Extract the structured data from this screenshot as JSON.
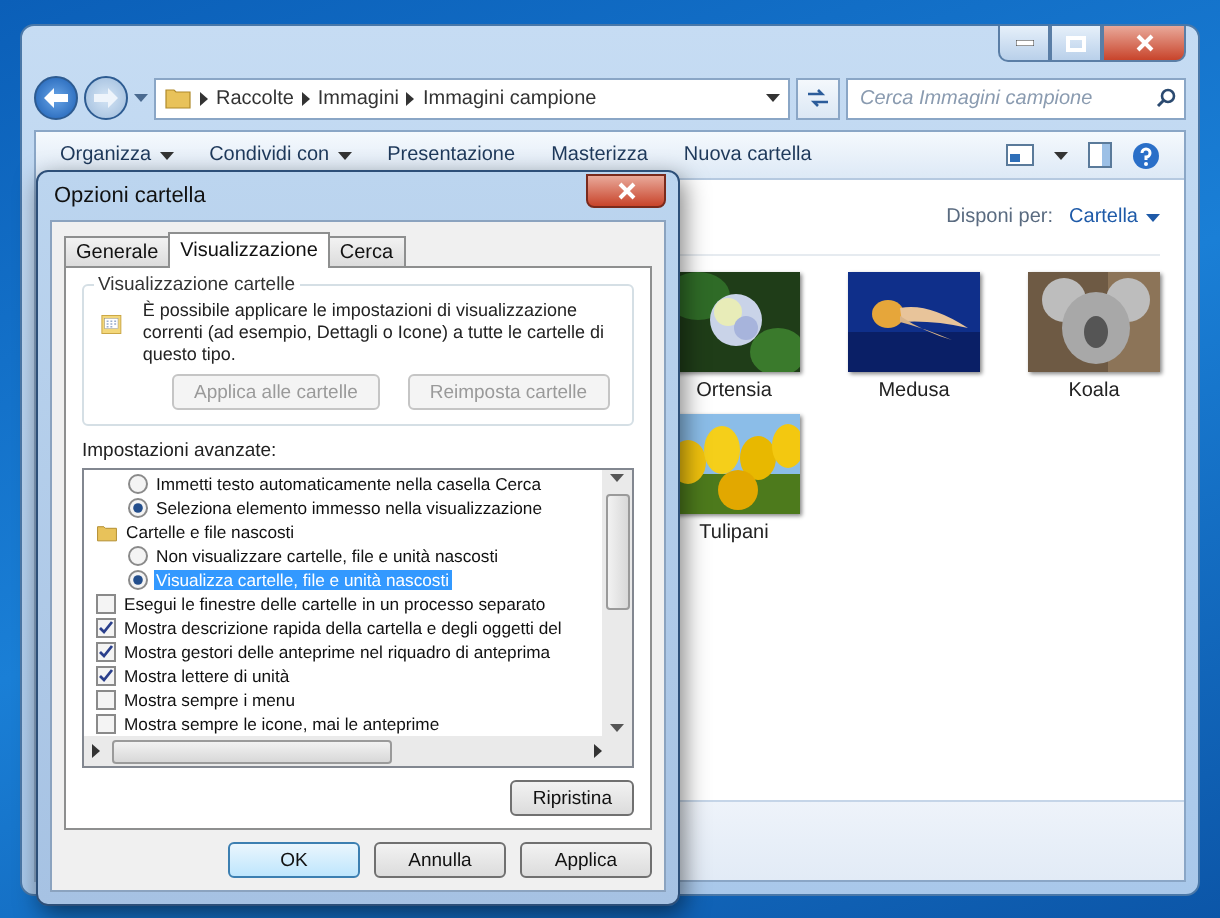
{
  "explorer": {
    "breadcrumb": [
      "Raccolte",
      "Immagini",
      "Immagini campione"
    ],
    "search": {
      "placeholder": "Cerca Immagini campione"
    },
    "toolbar": [
      {
        "label": "Organizza",
        "dropdown": true
      },
      {
        "label": "Condividi con",
        "dropdown": true
      },
      {
        "label": "Presentazione",
        "dropdown": false
      },
      {
        "label": "Masterizza",
        "dropdown": false
      },
      {
        "label": "Nuova cartella",
        "dropdown": false
      }
    ],
    "arrange_label": "Disponi per:",
    "arrange_value": "Cartella",
    "items": [
      {
        "label": "Ortensia",
        "kind": "picture"
      },
      {
        "label": "Medusa",
        "kind": "picture"
      },
      {
        "label": "Koala",
        "kind": "picture"
      },
      {
        "label": "Tulipani",
        "kind": "picture"
      }
    ]
  },
  "dialog": {
    "title": "Opzioni cartella",
    "tabs": [
      {
        "label": "Generale",
        "selected": false
      },
      {
        "label": "Visualizzazione",
        "selected": true
      },
      {
        "label": "Cerca",
        "selected": false
      }
    ],
    "group_title": "Visualizzazione cartelle",
    "group_text": "È possibile applicare le impostazioni di visualizzazione correnti (ad esempio, Dettagli o Icone) a tutte le cartelle di questo tipo.",
    "group_buttons": [
      {
        "label": "Applica alle cartelle",
        "disabled": true
      },
      {
        "label": "Reimposta cartelle",
        "disabled": true
      }
    ],
    "advanced_label": "Impostazioni avanzate:",
    "settings": [
      {
        "kind": "radio",
        "label": "Immetti testo automaticamente nella casella Cerca",
        "checked": false,
        "selected": false
      },
      {
        "kind": "radio",
        "label": "Seleziona elemento immesso nella visualizzazione",
        "checked": true,
        "selected": false
      },
      {
        "kind": "folder",
        "label": "Cartelle e file nascosti",
        "selected": false,
        "children": [
          {
            "kind": "radio",
            "label": "Non visualizzare cartelle, file e unità nascosti",
            "checked": false,
            "selected": false
          },
          {
            "kind": "radio",
            "label": "Visualizza cartelle, file e unità nascosti",
            "checked": true,
            "selected": true
          }
        ]
      },
      {
        "kind": "checkbox",
        "label": "Esegui le finestre delle cartelle in un processo separato",
        "checked": false,
        "selected": false
      },
      {
        "kind": "checkbox",
        "label": "Mostra descrizione rapida della cartella e degli oggetti del",
        "checked": true,
        "selected": false
      },
      {
        "kind": "checkbox",
        "label": "Mostra gestori delle anteprime nel riquadro di anteprima",
        "checked": true,
        "selected": false
      },
      {
        "kind": "checkbox",
        "label": "Mostra lettere di unità",
        "checked": true,
        "selected": false
      },
      {
        "kind": "checkbox",
        "label": "Mostra sempre i menu",
        "checked": false,
        "selected": false
      },
      {
        "kind": "checkbox",
        "label": "Mostra sempre le icone, mai le anteprime",
        "checked": false,
        "selected": false
      }
    ],
    "restore_button": "Ripristina",
    "buttons": [
      {
        "label": "OK",
        "default": true
      },
      {
        "label": "Annulla",
        "default": false
      },
      {
        "label": "Applica",
        "default": false
      }
    ]
  }
}
